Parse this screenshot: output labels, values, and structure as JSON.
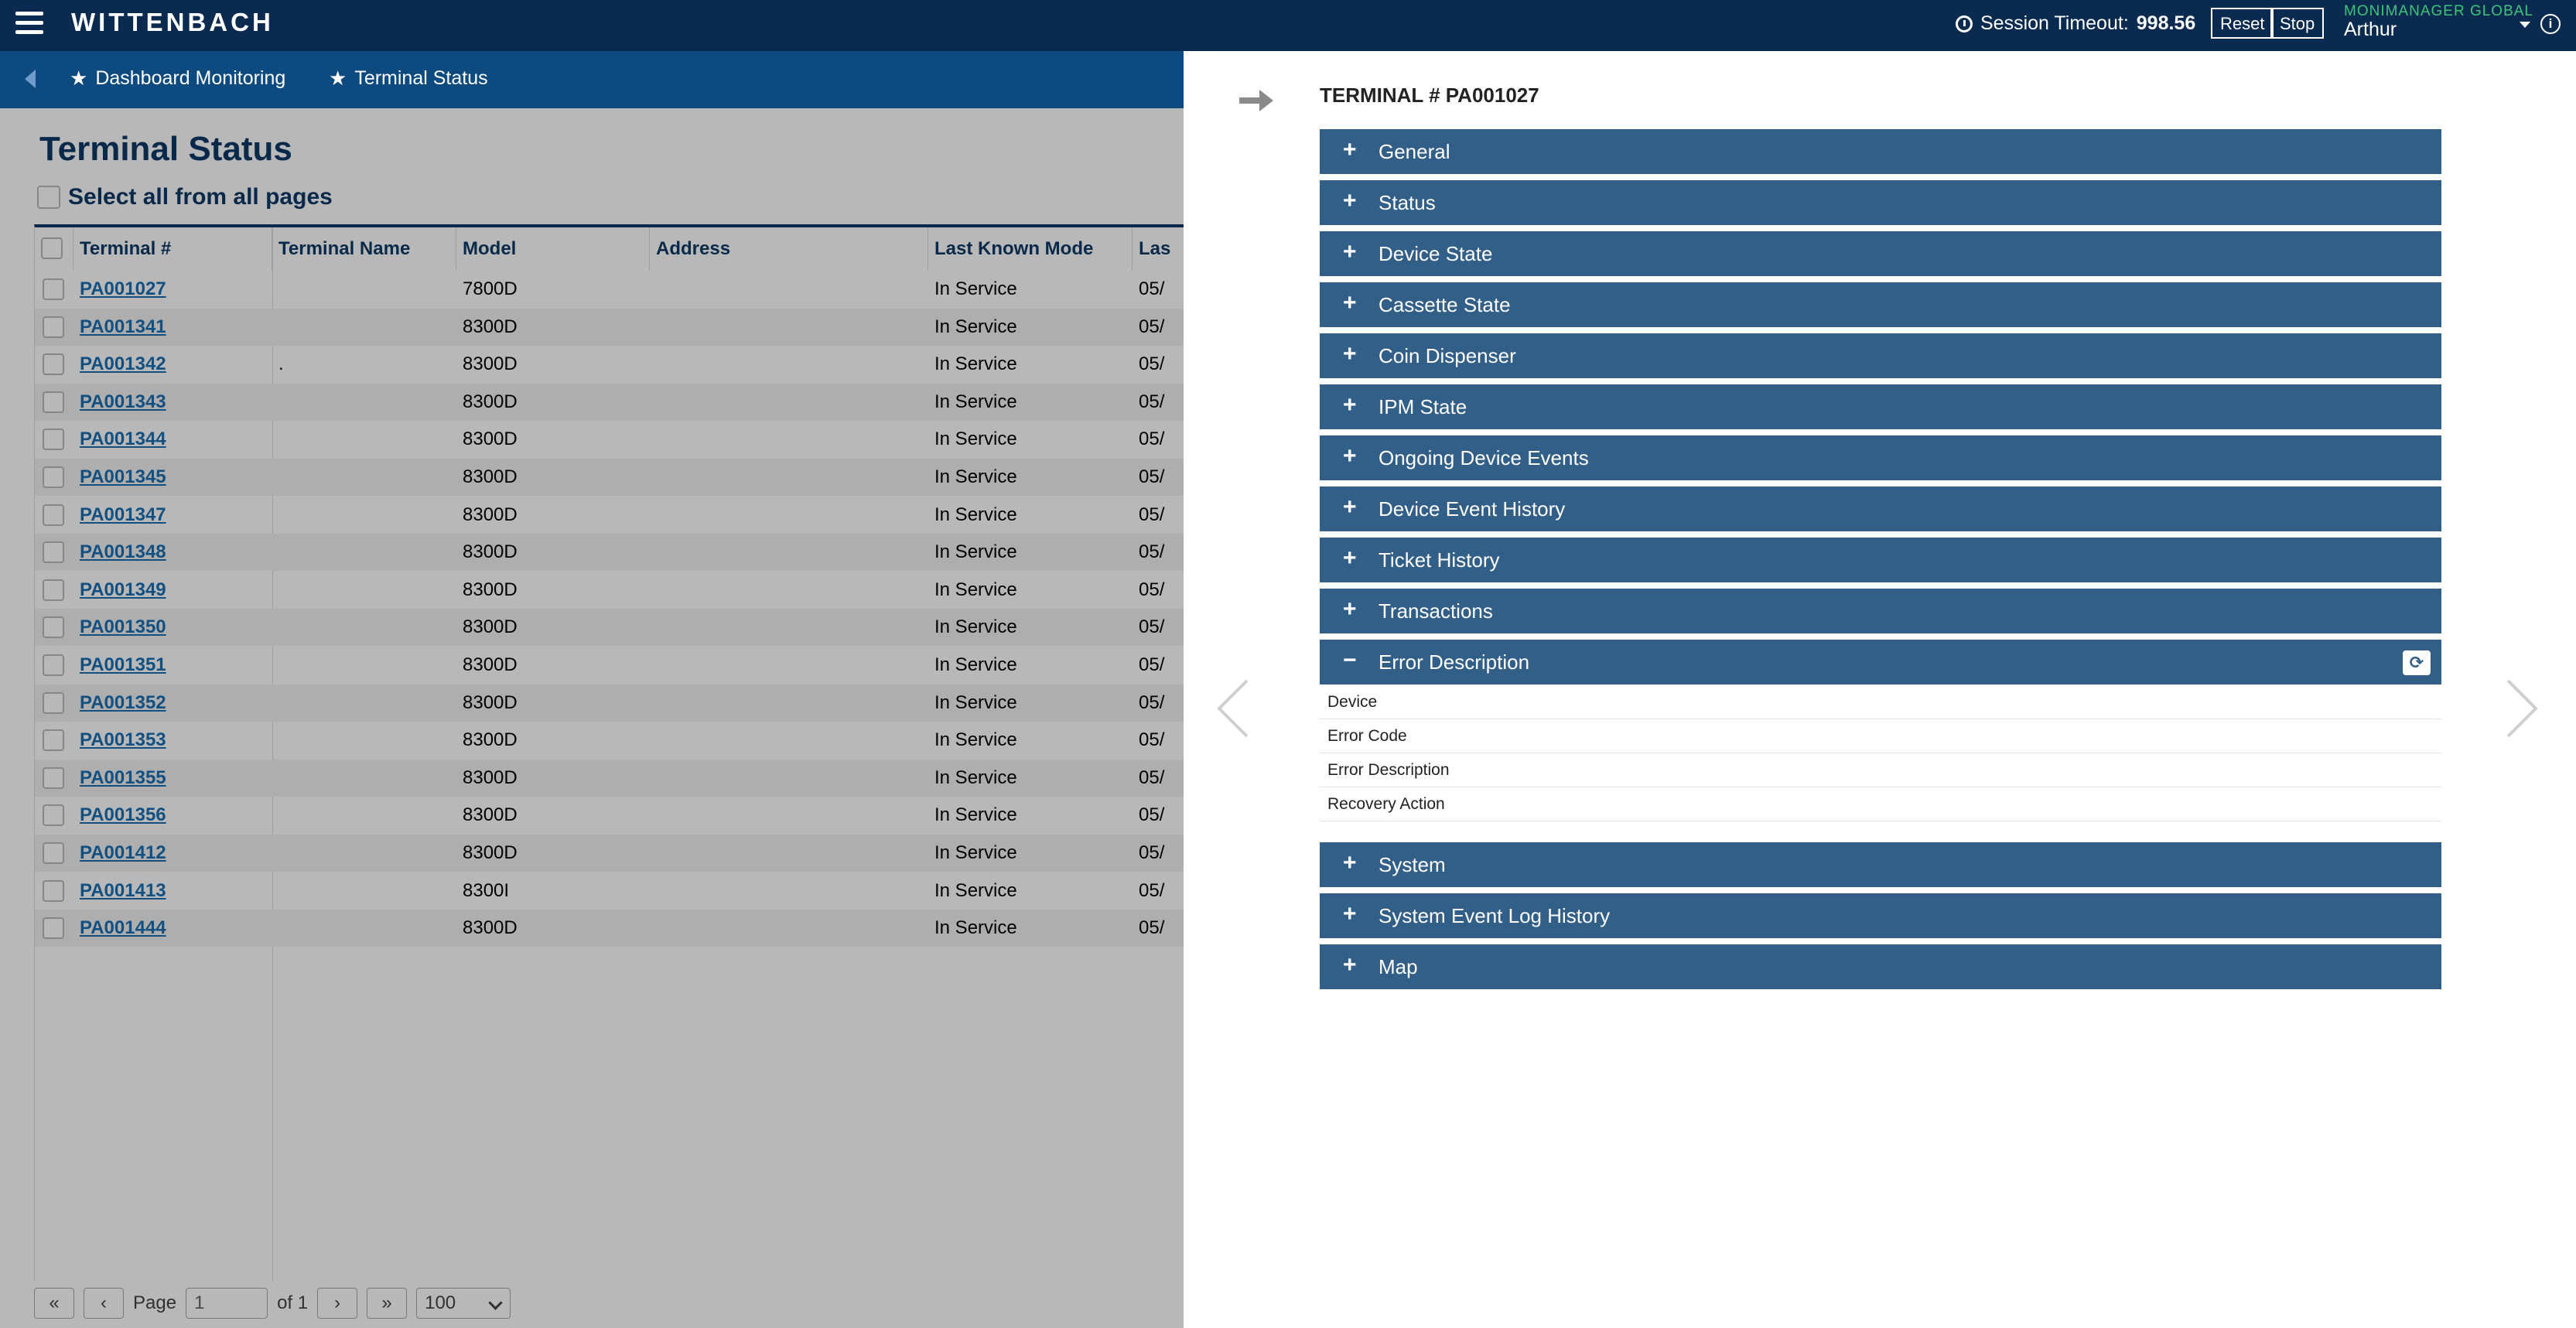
{
  "topbar": {
    "logo": "WITTENBACH",
    "session_label": "Session Timeout:",
    "session_value": "998.56",
    "reset_label": "Reset",
    "stop_label": "Stop",
    "org": "MONIMANAGER GLOBAL",
    "user": "Arthur",
    "info": "i"
  },
  "nav": {
    "items": [
      {
        "label": "Dashboard Monitoring"
      },
      {
        "label": "Terminal Status"
      }
    ]
  },
  "main": {
    "title": "Terminal Status",
    "select_all": "Select all from all pages",
    "columns": [
      "Terminal #",
      "Terminal Name",
      "Model",
      "Address",
      "Last Known Mode",
      "Las"
    ],
    "rows": [
      {
        "terminal": "PA001027",
        "name": "",
        "model": "7800D",
        "address": "",
        "mode": "In Service",
        "last": "05/"
      },
      {
        "terminal": "PA001341",
        "name": "",
        "model": "8300D",
        "address": "",
        "mode": "In Service",
        "last": "05/"
      },
      {
        "terminal": "PA001342",
        "name": ".",
        "model": "8300D",
        "address": "",
        "mode": "In Service",
        "last": "05/"
      },
      {
        "terminal": "PA001343",
        "name": "",
        "model": "8300D",
        "address": "",
        "mode": "In Service",
        "last": "05/"
      },
      {
        "terminal": "PA001344",
        "name": "",
        "model": "8300D",
        "address": "",
        "mode": "In Service",
        "last": "05/"
      },
      {
        "terminal": "PA001345",
        "name": "",
        "model": "8300D",
        "address": "",
        "mode": "In Service",
        "last": "05/"
      },
      {
        "terminal": "PA001347",
        "name": "",
        "model": "8300D",
        "address": "",
        "mode": "In Service",
        "last": "05/"
      },
      {
        "terminal": "PA001348",
        "name": "",
        "model": "8300D",
        "address": "",
        "mode": "In Service",
        "last": "05/"
      },
      {
        "terminal": "PA001349",
        "name": "",
        "model": "8300D",
        "address": "",
        "mode": "In Service",
        "last": "05/"
      },
      {
        "terminal": "PA001350",
        "name": "",
        "model": "8300D",
        "address": "",
        "mode": "In Service",
        "last": "05/"
      },
      {
        "terminal": "PA001351",
        "name": "",
        "model": "8300D",
        "address": "",
        "mode": "In Service",
        "last": "05/"
      },
      {
        "terminal": "PA001352",
        "name": "",
        "model": "8300D",
        "address": "",
        "mode": "In Service",
        "last": "05/"
      },
      {
        "terminal": "PA001353",
        "name": "",
        "model": "8300D",
        "address": "",
        "mode": "In Service",
        "last": "05/"
      },
      {
        "terminal": "PA001355",
        "name": "",
        "model": "8300D",
        "address": "",
        "mode": "In Service",
        "last": "05/"
      },
      {
        "terminal": "PA001356",
        "name": "",
        "model": "8300D",
        "address": "",
        "mode": "In Service",
        "last": "05/"
      },
      {
        "terminal": "PA001412",
        "name": "",
        "model": "8300D",
        "address": "",
        "mode": "In Service",
        "last": "05/"
      },
      {
        "terminal": "PA001413",
        "name": "",
        "model": "8300I",
        "address": "",
        "mode": "In Service",
        "last": "05/"
      },
      {
        "terminal": "PA001444",
        "name": "",
        "model": "8300D",
        "address": "",
        "mode": "In Service",
        "last": "05/"
      }
    ],
    "pager": {
      "first": "«",
      "prev": "‹",
      "page_label": "Page",
      "page_value": "1",
      "of_label": "of 1",
      "next": "›",
      "last": "»",
      "page_size": "100"
    }
  },
  "panel": {
    "title": "TERMINAL # PA001027",
    "sections_top": [
      {
        "label": "General",
        "sign": "+"
      },
      {
        "label": "Status",
        "sign": "+"
      },
      {
        "label": "Device State",
        "sign": "+"
      },
      {
        "label": "Cassette State",
        "sign": "+"
      },
      {
        "label": "Coin Dispenser",
        "sign": "+"
      },
      {
        "label": "IPM State",
        "sign": "+"
      },
      {
        "label": "Ongoing Device Events",
        "sign": "+"
      },
      {
        "label": "Device Event History",
        "sign": "+"
      },
      {
        "label": "Ticket History",
        "sign": "+"
      },
      {
        "label": "Transactions",
        "sign": "+"
      }
    ],
    "expanded": {
      "label": "Error Description",
      "sign": "−"
    },
    "error_fields": [
      "Device",
      "Error Code",
      "Error Description",
      "Recovery Action"
    ],
    "sections_bottom": [
      {
        "label": "System",
        "sign": "+"
      },
      {
        "label": "System Event Log History",
        "sign": "+"
      },
      {
        "label": "Map",
        "sign": "+"
      }
    ]
  },
  "colors": {
    "topbar": "#0a2b4f",
    "navbar": "#0c4a80",
    "accordion": "#325f88",
    "link": "#1a6fb5",
    "org": "#3ec47a"
  }
}
